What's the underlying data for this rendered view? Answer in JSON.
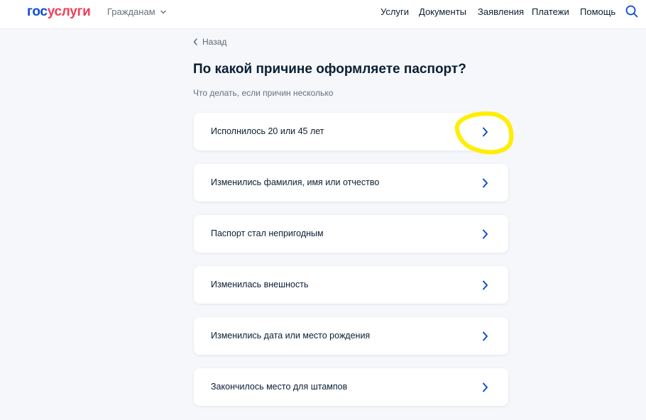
{
  "header": {
    "logo_part1": "гос",
    "logo_part2": "услуги",
    "audience": "Гражданам",
    "nav": [
      "Услуги",
      "Документы",
      "Заявления",
      "Платежи",
      "Помощь"
    ],
    "search_icon": "search-icon"
  },
  "page": {
    "back_label": "Назад",
    "title": "По какой причине оформляете паспорт?",
    "hint": "Что делать, если причин несколько"
  },
  "options": [
    {
      "label": "Исполнилось 20 или 45 лет"
    },
    {
      "label": "Изменились фамилия, имя или отчество"
    },
    {
      "label": "Паспорт стал непригодным"
    },
    {
      "label": "Изменилась внешность"
    },
    {
      "label": "Изменились дата или место рождения"
    },
    {
      "label": "Закончилось место для штампов"
    }
  ],
  "colors": {
    "brand_blue": "#0d4cd3",
    "brand_red": "#ee3f58",
    "arrow": "#0d4cd3",
    "highlight": "#ffee00"
  }
}
